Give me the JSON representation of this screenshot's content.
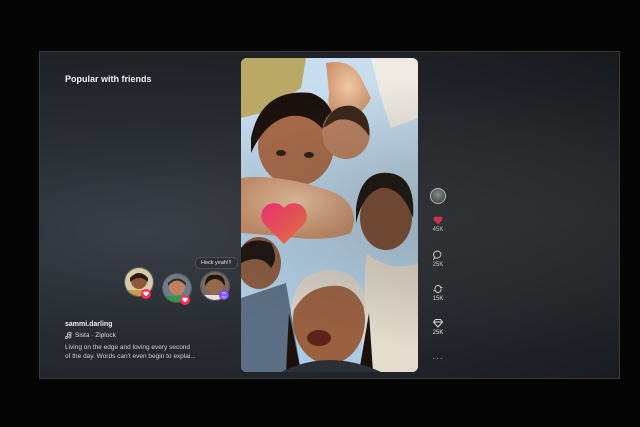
{
  "section_title": "Popular with friends",
  "friend_comment": "Heck yeah!!!",
  "post": {
    "username": "sammi.darling",
    "song": "Sista · Ziplock",
    "description_line1": "Living on the edge and loving every second",
    "description_line2": "of the day. Words can't even begin to explai..."
  },
  "actions": {
    "likes": "45K",
    "comments": "25K",
    "reposts": "15K",
    "shares": "25K"
  },
  "colors": {
    "like_red": "#fe2c55",
    "heart_pink": "#ff2d7a",
    "heart_orange": "#ff7a3c",
    "repost_purple": "#7a4dff"
  }
}
